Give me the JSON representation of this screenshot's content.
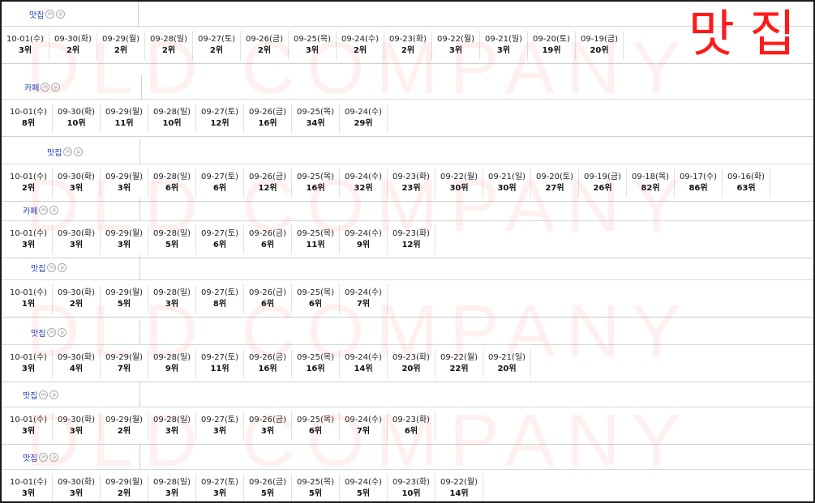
{
  "title": "맛집",
  "watermark": "DLD COMPANY",
  "blocks": [
    {
      "keyword": "맛집",
      "entries": [
        {
          "date": "10-01(수)",
          "rank": "3위"
        },
        {
          "date": "09-30(화)",
          "rank": "2위"
        },
        {
          "date": "09-29(월)",
          "rank": "2위"
        },
        {
          "date": "09-28(일)",
          "rank": "2위"
        },
        {
          "date": "09-27(토)",
          "rank": "2위"
        },
        {
          "date": "09-26(금)",
          "rank": "2위"
        },
        {
          "date": "09-25(목)",
          "rank": "3위"
        },
        {
          "date": "09-24(수)",
          "rank": "2위"
        },
        {
          "date": "09-23(화)",
          "rank": "2위"
        },
        {
          "date": "09-22(월)",
          "rank": "3위"
        },
        {
          "date": "09-21(일)",
          "rank": "3위"
        },
        {
          "date": "09-20(토)",
          "rank": "19위"
        },
        {
          "date": "09-19(금)",
          "rank": "20위"
        }
      ]
    },
    {
      "keyword": "카페",
      "entries": [
        {
          "date": "10-01(수)",
          "rank": "8위"
        },
        {
          "date": "09-30(화)",
          "rank": "10위"
        },
        {
          "date": "09-29(월)",
          "rank": "11위"
        },
        {
          "date": "09-28(일)",
          "rank": "10위"
        },
        {
          "date": "09-27(토)",
          "rank": "12위"
        },
        {
          "date": "09-26(금)",
          "rank": "16위"
        },
        {
          "date": "09-25(목)",
          "rank": "34위"
        },
        {
          "date": "09-24(수)",
          "rank": "29위"
        }
      ]
    },
    {
      "keyword": "맛집",
      "entries": [
        {
          "date": "10-01(수)",
          "rank": "2위"
        },
        {
          "date": "09-30(화)",
          "rank": "3위"
        },
        {
          "date": "09-29(월)",
          "rank": "3위"
        },
        {
          "date": "09-28(일)",
          "rank": "6위"
        },
        {
          "date": "09-27(토)",
          "rank": "6위"
        },
        {
          "date": "09-26(금)",
          "rank": "12위"
        },
        {
          "date": "09-25(목)",
          "rank": "16위"
        },
        {
          "date": "09-24(수)",
          "rank": "32위"
        },
        {
          "date": "09-23(화)",
          "rank": "23위"
        },
        {
          "date": "09-22(월)",
          "rank": "30위"
        },
        {
          "date": "09-21(일)",
          "rank": "30위"
        },
        {
          "date": "09-20(토)",
          "rank": "27위"
        },
        {
          "date": "09-19(금)",
          "rank": "26위"
        },
        {
          "date": "09-18(목)",
          "rank": "82위"
        },
        {
          "date": "09-17(수)",
          "rank": "86위"
        },
        {
          "date": "09-16(화)",
          "rank": "63위"
        }
      ]
    },
    {
      "keyword": "카페",
      "entries": [
        {
          "date": "10-01(수)",
          "rank": "3위"
        },
        {
          "date": "09-30(화)",
          "rank": "3위"
        },
        {
          "date": "09-29(월)",
          "rank": "3위"
        },
        {
          "date": "09-28(일)",
          "rank": "5위"
        },
        {
          "date": "09-27(토)",
          "rank": "6위"
        },
        {
          "date": "09-26(금)",
          "rank": "6위"
        },
        {
          "date": "09-25(목)",
          "rank": "11위"
        },
        {
          "date": "09-24(수)",
          "rank": "9위"
        },
        {
          "date": "09-23(화)",
          "rank": "12위"
        }
      ]
    },
    {
      "keyword": "맛집",
      "entries": [
        {
          "date": "10-01(수)",
          "rank": "1위"
        },
        {
          "date": "09-30(화)",
          "rank": "2위"
        },
        {
          "date": "09-29(월)",
          "rank": "5위"
        },
        {
          "date": "09-28(일)",
          "rank": "3위"
        },
        {
          "date": "09-27(토)",
          "rank": "8위"
        },
        {
          "date": "09-26(금)",
          "rank": "6위"
        },
        {
          "date": "09-25(목)",
          "rank": "6위"
        },
        {
          "date": "09-24(수)",
          "rank": "7위"
        }
      ]
    },
    {
      "keyword": "맛집",
      "entries": [
        {
          "date": "10-01(수)",
          "rank": "3위"
        },
        {
          "date": "09-30(화)",
          "rank": "4위"
        },
        {
          "date": "09-29(월)",
          "rank": "7위"
        },
        {
          "date": "09-28(일)",
          "rank": "9위"
        },
        {
          "date": "09-27(토)",
          "rank": "11위"
        },
        {
          "date": "09-26(금)",
          "rank": "16위"
        },
        {
          "date": "09-25(목)",
          "rank": "16위"
        },
        {
          "date": "09-24(수)",
          "rank": "14위"
        },
        {
          "date": "09-23(화)",
          "rank": "20위"
        },
        {
          "date": "09-22(월)",
          "rank": "22위"
        },
        {
          "date": "09-21(일)",
          "rank": "20위"
        }
      ]
    },
    {
      "keyword": "맛집",
      "entries": [
        {
          "date": "10-01(수)",
          "rank": "3위"
        },
        {
          "date": "09-30(화)",
          "rank": "3위"
        },
        {
          "date": "09-29(월)",
          "rank": "2위"
        },
        {
          "date": "09-28(일)",
          "rank": "3위"
        },
        {
          "date": "09-27(토)",
          "rank": "3위"
        },
        {
          "date": "09-26(금)",
          "rank": "3위"
        },
        {
          "date": "09-25(목)",
          "rank": "6위"
        },
        {
          "date": "09-24(수)",
          "rank": "7위"
        },
        {
          "date": "09-23(화)",
          "rank": "6위"
        }
      ]
    },
    {
      "keyword": "맛집",
      "entries": [
        {
          "date": "10-01(수)",
          "rank": "3위"
        },
        {
          "date": "09-30(화)",
          "rank": "3위"
        },
        {
          "date": "09-29(월)",
          "rank": "2위"
        },
        {
          "date": "09-28(일)",
          "rank": "3위"
        },
        {
          "date": "09-27(토)",
          "rank": "3위"
        },
        {
          "date": "09-26(금)",
          "rank": "5위"
        },
        {
          "date": "09-25(목)",
          "rank": "5위"
        },
        {
          "date": "09-24(수)",
          "rank": "5위"
        },
        {
          "date": "09-23(화)",
          "rank": "10위"
        },
        {
          "date": "09-22(월)",
          "rank": "14위"
        }
      ]
    }
  ]
}
